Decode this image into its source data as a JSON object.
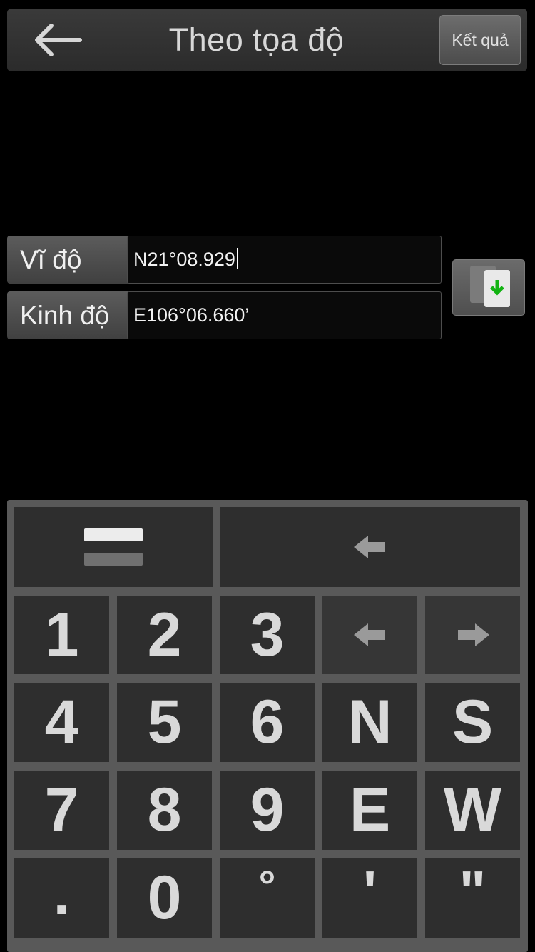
{
  "header": {
    "title": "Theo tọa độ",
    "result_label": "Kết quả",
    "back_icon": "arrow-left-icon"
  },
  "latitude": {
    "label": "Vĩ độ",
    "value": "N21°08.929"
  },
  "longitude": {
    "label": "Kinh độ",
    "value": "E106°06.660’"
  },
  "paste_icon": "paste-icon",
  "keypad": {
    "mode_icon": "toggle-lines-icon",
    "backspace_icon": "backspace-arrow-icon",
    "cursor_left_icon": "cursor-left-icon",
    "cursor_right_icon": "cursor-right-icon",
    "keys": [
      "1",
      "2",
      "3",
      "4",
      "5",
      "6",
      "N",
      "S",
      "7",
      "8",
      "9",
      "E",
      "W",
      ".",
      "0",
      "°",
      "'",
      "\""
    ]
  },
  "colors": {
    "accent_green": "#12b312",
    "key_bg": "#2e2e2e",
    "keyboard_bg": "#595959"
  }
}
